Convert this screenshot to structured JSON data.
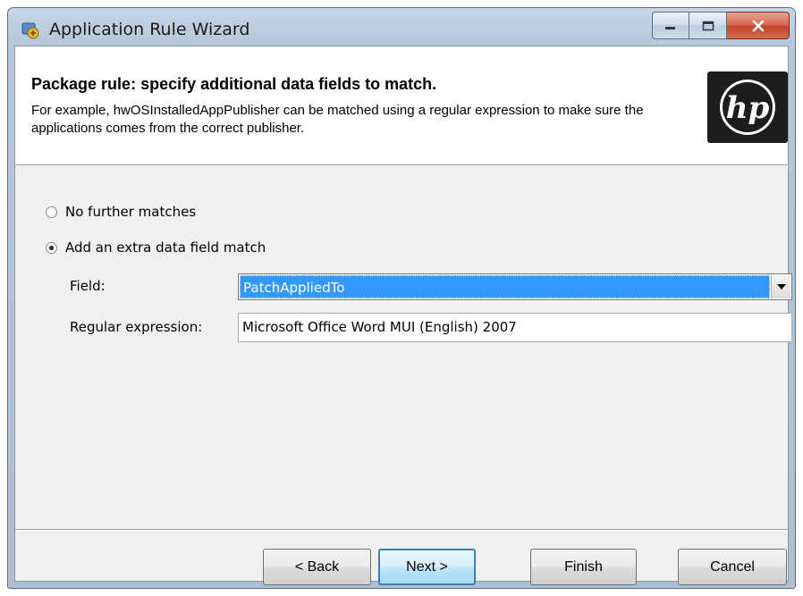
{
  "window": {
    "title": "Application Rule Wizard"
  },
  "header": {
    "title": "Package rule: specify additional data fields to match.",
    "description": "For example, hwOSInstalledAppPublisher can be matched using a regular expression to make sure the applications comes from the correct publisher.",
    "logo_text": "hp"
  },
  "options": {
    "no_further": "No further matches",
    "add_extra": "Add an extra data field match",
    "selected": "add_extra"
  },
  "form": {
    "field_label": "Field:",
    "field_value": "PatchAppliedTo",
    "regex_label": "Regular expression:",
    "regex_value": "Microsoft Office Word MUI (English) 2007"
  },
  "buttons": {
    "back": "< Back",
    "next": "Next >",
    "finish": "Finish",
    "cancel": "Cancel"
  },
  "colors": {
    "selection": "#3399ff",
    "close_button": "#c4432a",
    "default_button_border": "#3c7fb1"
  }
}
